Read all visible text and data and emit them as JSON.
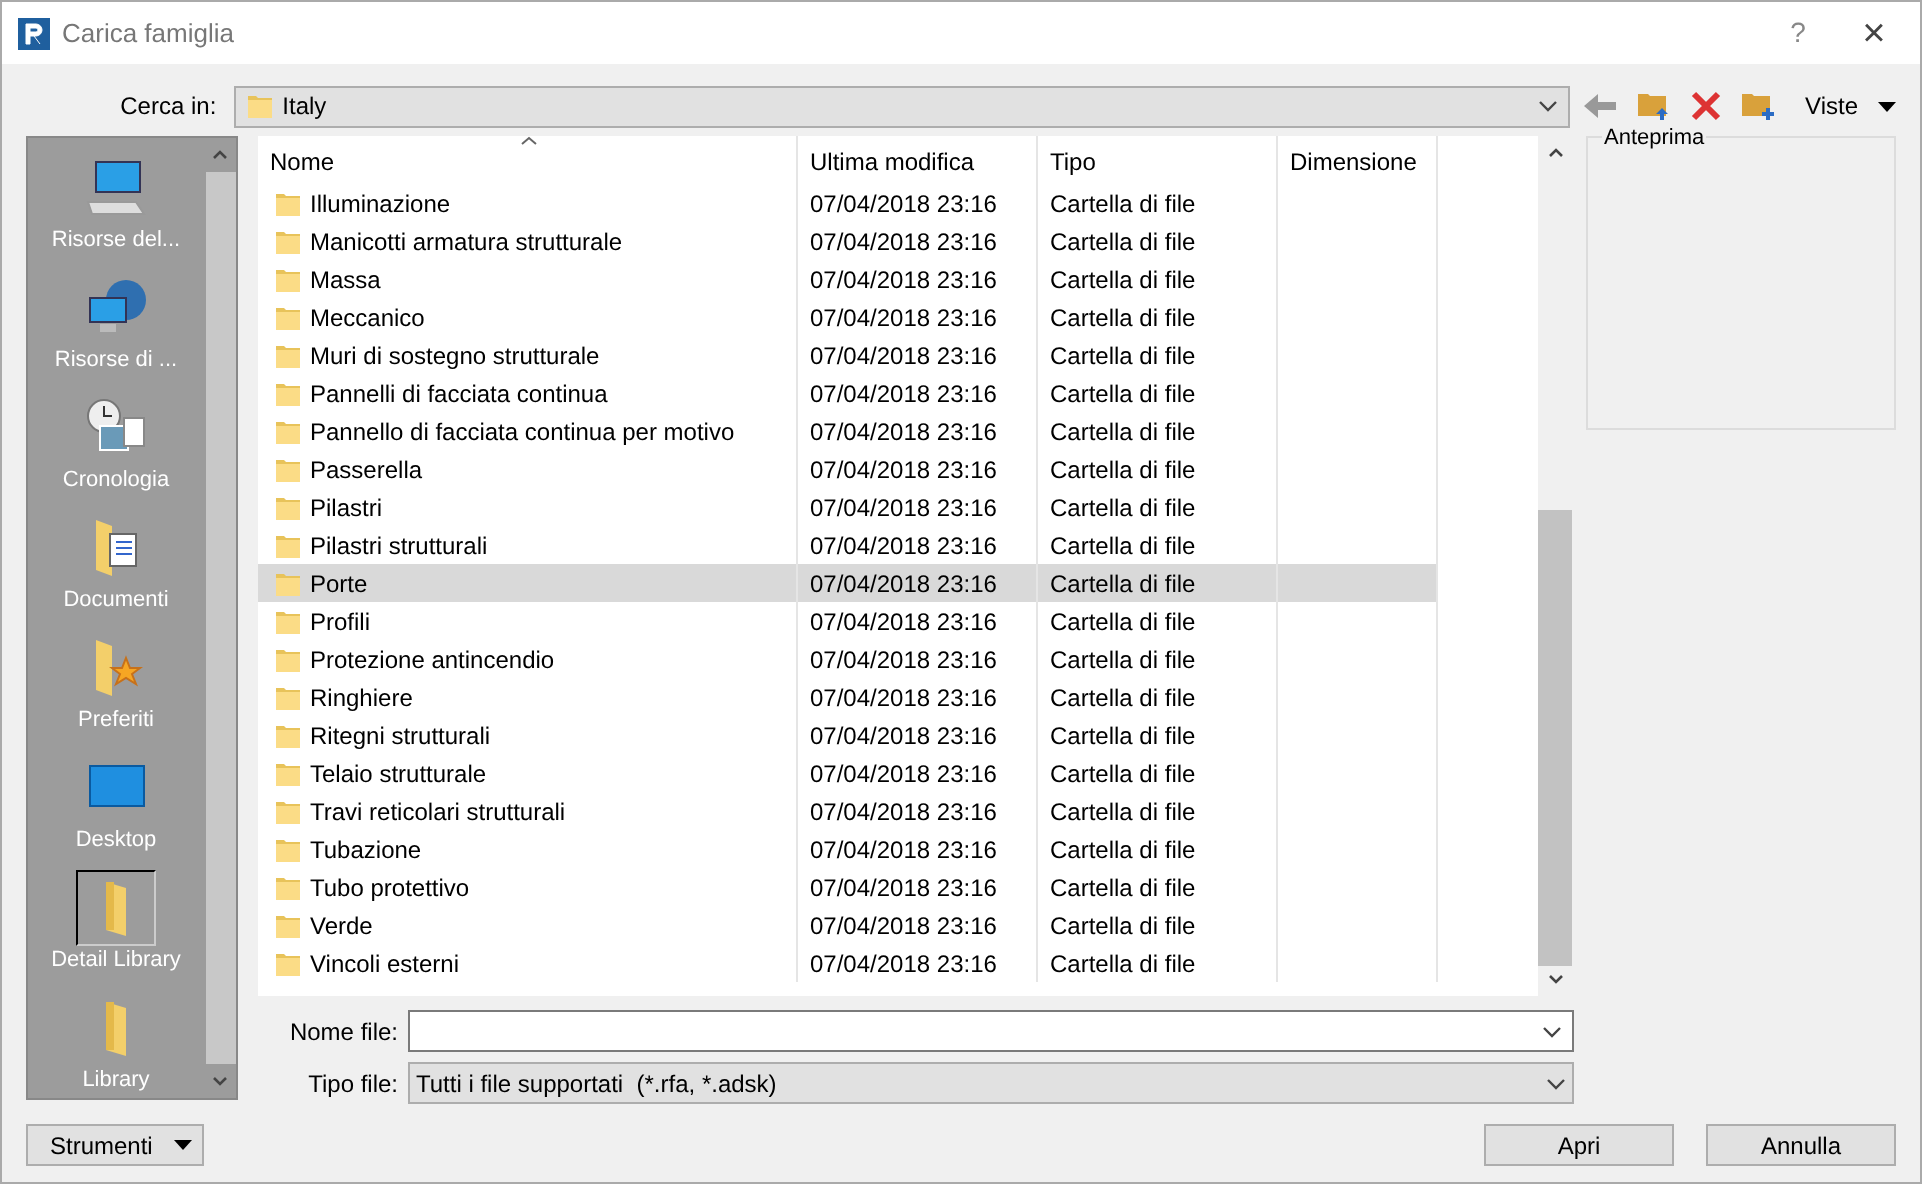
{
  "window": {
    "title": "Carica famiglia",
    "help": "?",
    "close": "×"
  },
  "look_in": {
    "label": "Cerca in:",
    "value": "Italy"
  },
  "toolbar": {
    "views": "Viste"
  },
  "places": [
    {
      "label": "Risorse del...",
      "kind": "computer",
      "selected": false
    },
    {
      "label": "Risorse di ...",
      "kind": "network",
      "selected": false
    },
    {
      "label": "Cronologia",
      "kind": "history",
      "selected": false
    },
    {
      "label": "Documenti",
      "kind": "documents",
      "selected": false
    },
    {
      "label": "Preferiti",
      "kind": "favorites",
      "selected": false
    },
    {
      "label": "Desktop",
      "kind": "desktop",
      "selected": false
    },
    {
      "label": "Detail Library",
      "kind": "folder",
      "selected": true
    },
    {
      "label": "Library",
      "kind": "folder",
      "selected": false
    }
  ],
  "table": {
    "columns": [
      "Nome",
      "Ultima modifica",
      "Tipo",
      "Dimensione"
    ],
    "rows": [
      {
        "name": "Illuminazione",
        "modified": "07/04/2018 23:16",
        "type": "Cartella di file",
        "selected": false
      },
      {
        "name": "Manicotti armatura strutturale",
        "modified": "07/04/2018 23:16",
        "type": "Cartella di file",
        "selected": false
      },
      {
        "name": "Massa",
        "modified": "07/04/2018 23:16",
        "type": "Cartella di file",
        "selected": false
      },
      {
        "name": "Meccanico",
        "modified": "07/04/2018 23:16",
        "type": "Cartella di file",
        "selected": false
      },
      {
        "name": "Muri di sostegno strutturale",
        "modified": "07/04/2018 23:16",
        "type": "Cartella di file",
        "selected": false
      },
      {
        "name": "Pannelli di facciata continua",
        "modified": "07/04/2018 23:16",
        "type": "Cartella di file",
        "selected": false
      },
      {
        "name": "Pannello di facciata continua per motivo",
        "modified": "07/04/2018 23:16",
        "type": "Cartella di file",
        "selected": false
      },
      {
        "name": "Passerella",
        "modified": "07/04/2018 23:16",
        "type": "Cartella di file",
        "selected": false
      },
      {
        "name": "Pilastri",
        "modified": "07/04/2018 23:16",
        "type": "Cartella di file",
        "selected": false
      },
      {
        "name": "Pilastri strutturali",
        "modified": "07/04/2018 23:16",
        "type": "Cartella di file",
        "selected": false
      },
      {
        "name": "Porte",
        "modified": "07/04/2018 23:16",
        "type": "Cartella di file",
        "selected": true
      },
      {
        "name": "Profili",
        "modified": "07/04/2018 23:16",
        "type": "Cartella di file",
        "selected": false
      },
      {
        "name": "Protezione antincendio",
        "modified": "07/04/2018 23:16",
        "type": "Cartella di file",
        "selected": false
      },
      {
        "name": "Ringhiere",
        "modified": "07/04/2018 23:16",
        "type": "Cartella di file",
        "selected": false
      },
      {
        "name": "Ritegni strutturali",
        "modified": "07/04/2018 23:16",
        "type": "Cartella di file",
        "selected": false
      },
      {
        "name": "Telaio strutturale",
        "modified": "07/04/2018 23:16",
        "type": "Cartella di file",
        "selected": false
      },
      {
        "name": "Travi reticolari strutturali",
        "modified": "07/04/2018 23:16",
        "type": "Cartella di file",
        "selected": false
      },
      {
        "name": "Tubazione",
        "modified": "07/04/2018 23:16",
        "type": "Cartella di file",
        "selected": false
      },
      {
        "name": "Tubo protettivo",
        "modified": "07/04/2018 23:16",
        "type": "Cartella di file",
        "selected": false
      },
      {
        "name": "Verde",
        "modified": "07/04/2018 23:16",
        "type": "Cartella di file",
        "selected": false
      },
      {
        "name": "Vincoli esterni",
        "modified": "07/04/2018 23:16",
        "type": "Cartella di file",
        "selected": false
      }
    ]
  },
  "preview": {
    "label": "Anteprima"
  },
  "file_name": {
    "label": "Nome file:"
  },
  "file_type": {
    "label": "Tipo file:",
    "value": "Tutti i file supportati  (*.rfa, *.adsk)"
  },
  "buttons": {
    "tools": "Strumenti",
    "open": "Apri",
    "cancel": "Annulla"
  }
}
